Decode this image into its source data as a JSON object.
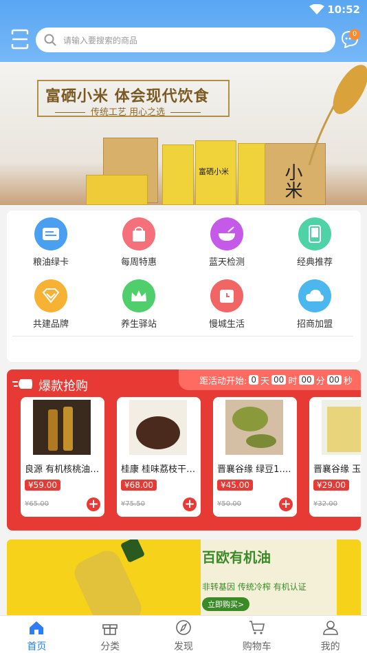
{
  "status_bar": {
    "time": "10:52"
  },
  "header": {
    "search_placeholder": "请输入要搜索的商品",
    "message_badge": "0"
  },
  "banner": {
    "title": "富硒小米 体会现代饮食",
    "subtitle": "传统工艺 用心之选",
    "box_text": "小米",
    "bag_text": "富硒小米"
  },
  "grid": [
    {
      "label": "粮油绿卡",
      "icon": "card-icon",
      "color": "#4a9ff0"
    },
    {
      "label": "每周特惠",
      "icon": "shopping-bag-icon",
      "color": "#f5707a"
    },
    {
      "label": "蓝天检测",
      "icon": "bowl-icon",
      "color": "#c55ae8"
    },
    {
      "label": "经典推荐",
      "icon": "tablet-icon",
      "color": "#4fd2a5"
    },
    {
      "label": "共建品牌",
      "icon": "diamond-icon",
      "color": "#f7b133"
    },
    {
      "label": "养生驿站",
      "icon": "crown-icon",
      "color": "#4fcf6b"
    },
    {
      "label": "慢城生活",
      "icon": "clock-icon",
      "color": "#f26565"
    },
    {
      "label": "招商加盟",
      "icon": "cloud-icon",
      "color": "#4cb7ef"
    }
  ],
  "flash_sale": {
    "title": "爆款抢购",
    "countdown_label": "距活动开始:",
    "countdown": {
      "days": "0",
      "days_unit": "天",
      "hours": "00",
      "hours_unit": "时",
      "minutes": "00",
      "minutes_unit": "分",
      "seconds": "00",
      "seconds_unit": "秒"
    },
    "products": [
      {
        "name": "良源 有机核桃油5...",
        "price": "¥59.00",
        "old_price": "¥65.00"
      },
      {
        "name": "桂康 桂味荔枝干3...",
        "price": "¥68.00",
        "old_price": "¥75.50"
      },
      {
        "name": "晋襄谷缘 绿豆1.5...",
        "price": "¥45.00",
        "old_price": "¥50.00"
      },
      {
        "name": "晋襄谷缘 玉",
        "price": "¥29.00",
        "old_price": "¥32.00"
      }
    ]
  },
  "promo": {
    "title": "百欧有机油",
    "subtitle": "非转基因 传统冷榨 有机认证",
    "button": "立即购买>"
  },
  "tabs": [
    {
      "label": "首页",
      "icon": "home-icon"
    },
    {
      "label": "分类",
      "icon": "gift-icon"
    },
    {
      "label": "发现",
      "icon": "compass-icon"
    },
    {
      "label": "购物车",
      "icon": "cart-icon"
    },
    {
      "label": "我的",
      "icon": "user-icon"
    }
  ],
  "colors": {
    "primary": "#5aa6f3",
    "sale_red": "#e83a35",
    "tab_active": "#2f7df6"
  }
}
